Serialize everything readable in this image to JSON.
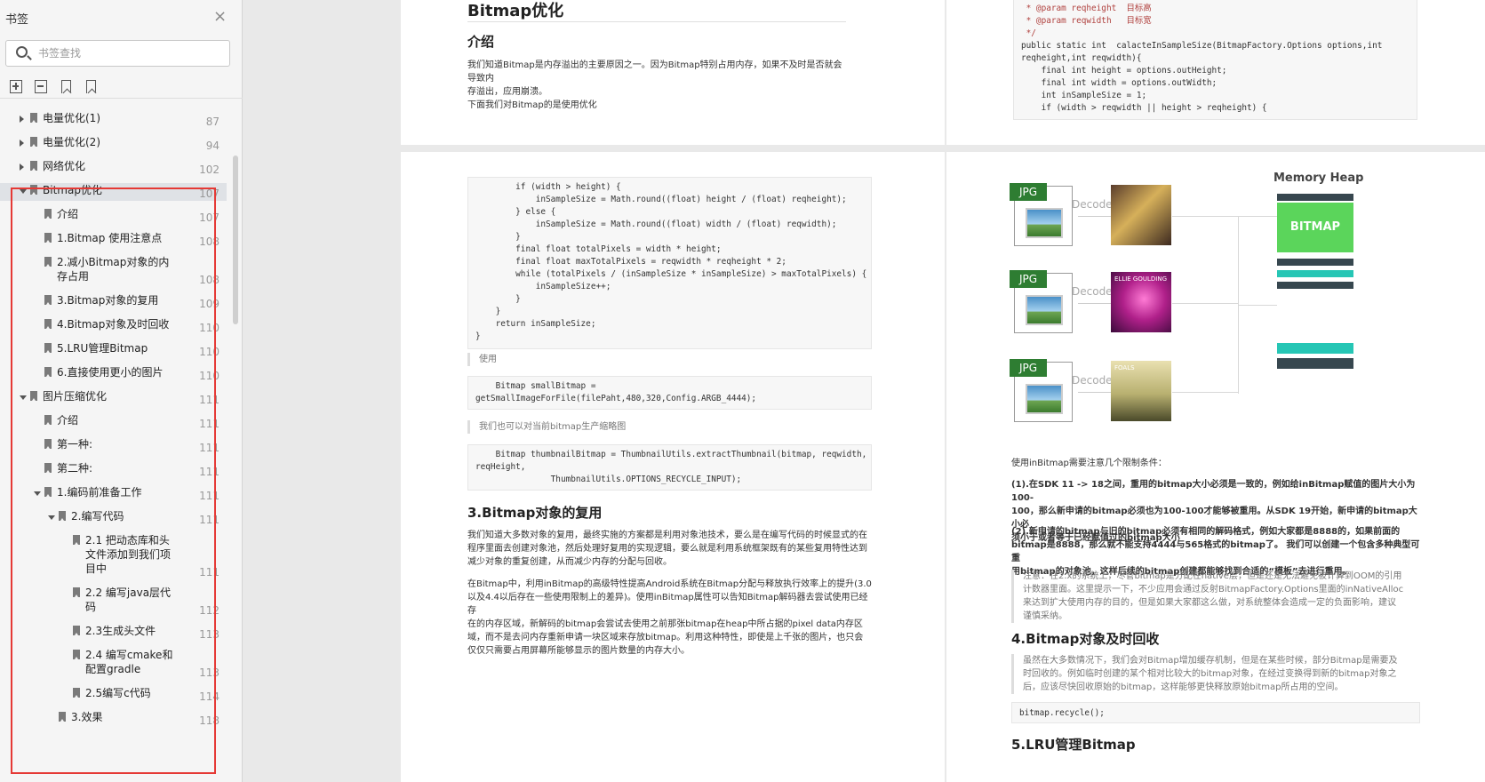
{
  "sidebar": {
    "title": "书签",
    "close_icon": "×",
    "search_placeholder": "书签查找",
    "toc": [
      {
        "label": "电量优化(1)",
        "page": "87"
      },
      {
        "label": "电量优化(2)",
        "page": "94"
      },
      {
        "label": "网络优化",
        "page": "102"
      },
      {
        "label": "Bitmap优化",
        "page": "107"
      },
      {
        "label": "介绍",
        "page": "107"
      },
      {
        "label": "1.Bitmap 使用注意点",
        "page": "108"
      },
      {
        "label": "2.减小Bitmap对象的内",
        "label2": "存占用",
        "page": "108"
      },
      {
        "label": "3.Bitmap对象的复用",
        "page": "109"
      },
      {
        "label": "4.Bitmap对象及时回收",
        "page": "110"
      },
      {
        "label": "5.LRU管理Bitmap",
        "page": "110"
      },
      {
        "label": "6.直接使用更小的图片",
        "page": "110"
      },
      {
        "label": "图片压缩优化",
        "page": "111"
      },
      {
        "label": "介绍",
        "page": "111"
      },
      {
        "label": "第一种:",
        "page": "111"
      },
      {
        "label": "第二种:",
        "page": "111"
      },
      {
        "label": "1.编码前准备工作",
        "page": "111"
      },
      {
        "label": "2.编写代码",
        "page": "111"
      },
      {
        "label": "2.1 把动态库和头",
        "label2": "文件添加到我们项",
        "label3": "目中",
        "page": "111"
      },
      {
        "label": "2.2 编写java层代",
        "label2": "码",
        "page": "112"
      },
      {
        "label": "2.3生成头文件",
        "page": "113"
      },
      {
        "label": "2.4 编写cmake和",
        "label2": "配置gradle",
        "page": "113"
      },
      {
        "label": "2.5编写c代码",
        "page": "114"
      },
      {
        "label": "3.效果",
        "page": "118"
      }
    ]
  },
  "page1": {
    "title": "Bitmap优化",
    "section": "介绍",
    "intro1": "我们知道Bitmap是内存溢出的主要原因之一。因为Bitmap特别占用内存，如果不及时是否就会导致内",
    "intro2": "存溢出，应用崩溃。",
    "intro3": "下面我们对Bitmap的是使用优化"
  },
  "page2": {
    "code": [
      " * @param reqheight  目标高",
      " * @param reqwidth   目标宽",
      " */",
      "public static int  calacteInSampleSize(BitmapFactory.Options options,int",
      "reqheight,int reqwidth){",
      "    final int height = options.outHeight;",
      "    final int width = options.outWidth;",
      "    int inSampleSize = 1;",
      "    if (width > reqwidth || height > reqheight) {"
    ]
  },
  "page3": {
    "code1": [
      "        if (width > height) {",
      "            inSampleSize = Math.round((float) height / (float) reqheight);",
      "        } else {",
      "            inSampleSize = Math.round((float) width / (float) reqwidth);",
      "        }",
      "        final float totalPixels = width * height;",
      "        final float maxTotalPixels = reqwidth * reqheight * 2;",
      "        while (totalPixels / (inSampleSize * inSampleSize) > maxTotalPixels) {",
      "            inSampleSize++;",
      "        }",
      "    }",
      "    return inSampleSize;",
      "}"
    ],
    "quote1": "使用",
    "code2": [
      "    Bitmap smallBitmap =",
      "getSmallImageForFile(filePaht,480,320,Config.ARGB_4444);"
    ],
    "quote2": "我们也可以对当前bitmap生产缩略图",
    "code3": [
      "    Bitmap thumbnailBitmap = ThumbnailUtils.extractThumbnail(bitmap, reqwidth,",
      "reqHeight,",
      "               ThumbnailUtils.OPTIONS_RECYCLE_INPUT);"
    ],
    "heading": "3.Bitmap对象的复用",
    "p1": [
      "我们知道大多数对象的复用，最终实施的方案都是利用对象池技术，要么是在编写代码的时候显式的在",
      "程序里面去创建对象池，然后处理好复用的实现逻辑，要么就是利用系统框架既有的某些复用特性达到",
      "减少对象的重复创建，从而减少内存的分配与回收。"
    ],
    "p2": [
      "在Bitmap中，利用inBitmap的高级特性提高Android系统在Bitmap分配与释放执行效率上的提升(3.0",
      "以及4.4以后存在一些使用限制上的差异)。使用inBitmap属性可以告知Bitmap解码器去尝试使用已经存",
      "在的内存区域，新解码的bitmap会尝试去使用之前那张bitmap在heap中所占据的pixel data内存区",
      "域，而不是去问内存重新申请一块区域来存放bitmap。利用这种特性，即使是上千张的图片，也只会",
      "仅仅只需要占用屏幕所能够显示的图片数量的内存大小。"
    ]
  },
  "page4": {
    "diagram": {
      "heap_title": "Memory Heap",
      "bitmap_label": "BITMAP",
      "jpg_label": "JPG",
      "decode_label": "Decode",
      "album2_text": "ELLIE GOULDING",
      "album3_text": "FOALS"
    },
    "intro": "使用inBitmap需要注意几个限制条件：",
    "p1": [
      "(1).在SDK 11 -> 18之间，重用的bitmap大小必须是一致的，例如给inBitmap赋值的图片大小为100-",
      "100，那么新申请的bitmap必须也为100-100才能够被重用。从SDK 19开始，新申请的bitmap大小必",
      "须小于或者等于已经赋值过的bitmap大小"
    ],
    "p2": [
      "(2).新申请的bitmap与旧的bitmap必须有相同的解码格式，例如大家都是8888的，如果前面的",
      "bitmap是8888，那么就不能支持4444与565格式的bitmap了。 我们可以创建一个包含多种典型可重",
      "用bitmap的对象池，这样后续的bitmap创建都能够找到合适的“模板”去进行重用。"
    ],
    "note": [
      "注意：在2.x的系统上，尽管bitmap是分配在native层，但是还是无法避免被计算到OOM的引用",
      "计数器里面。这里提示一下，不少应用会通过反射BitmapFactory.Options里面的inNativeAlloc",
      "来达到扩大使用内存的目的，但是如果大家都这么做，对系统整体会造成一定的负面影响，建议",
      "谨慎采纳。"
    ],
    "heading4": "4.Bitmap对象及时回收",
    "quote4": [
      "虽然在大多数情况下，我们会对Bitmap增加缓存机制，但是在某些时候，部分Bitmap是需要及",
      "时回收的。例如临时创建的某个相对比较大的bitmap对象，在经过变换得到新的bitmap对象之",
      "后，应该尽快回收原始的bitmap，这样能够更快释放原始bitmap所占用的空间。"
    ],
    "code": "bitmap.recycle();",
    "heading5": "5.LRU管理Bitmap"
  },
  "colors": {
    "accent_red": "#e53935",
    "bitmap_green": "#5bd55b",
    "bar_teal": "#26c6b5",
    "bar_dark": "#37474f"
  }
}
